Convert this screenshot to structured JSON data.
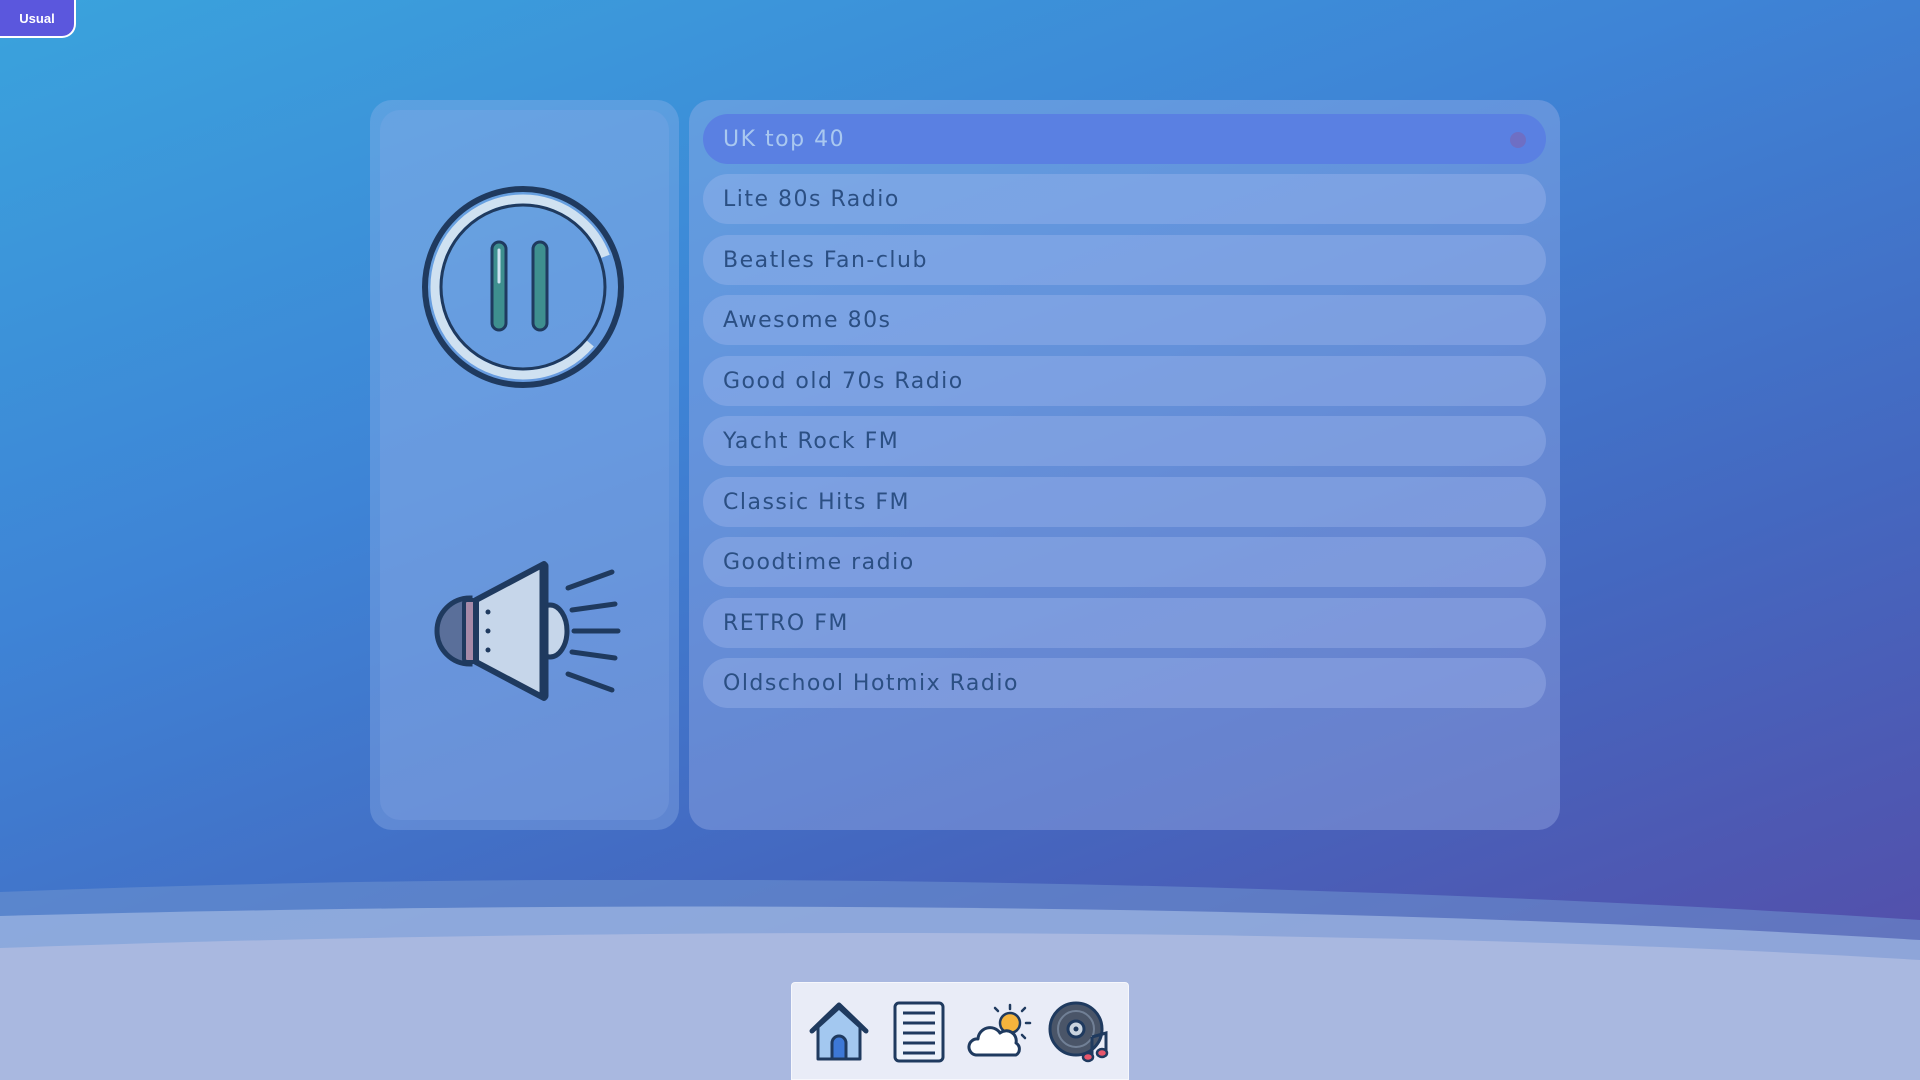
{
  "badge": {
    "label": "Usual"
  },
  "colors": {
    "accent": "#5a80e2",
    "icon_stroke": "#1f3a5f",
    "pause_bars": "#3e8f8f"
  },
  "player": {
    "state": "playing",
    "controls": [
      "pause-icon",
      "speaker-icon"
    ]
  },
  "stations": [
    {
      "name": "UK top 40",
      "active": true
    },
    {
      "name": "Lite 80s Radio",
      "active": false
    },
    {
      "name": "Beatles Fan-club",
      "active": false
    },
    {
      "name": "Awesome 80s",
      "active": false
    },
    {
      "name": "Good old 70s Radio",
      "active": false
    },
    {
      "name": "Yacht Rock FM",
      "active": false
    },
    {
      "name": "Classic Hits FM",
      "active": false
    },
    {
      "name": "Goodtime radio",
      "active": false
    },
    {
      "name": "RETRO FM",
      "active": false
    },
    {
      "name": "Oldschool Hotmix Radio",
      "active": false
    }
  ],
  "dock": {
    "items": [
      "home-icon",
      "list-icon",
      "weather-icon",
      "music-disc-icon"
    ]
  }
}
